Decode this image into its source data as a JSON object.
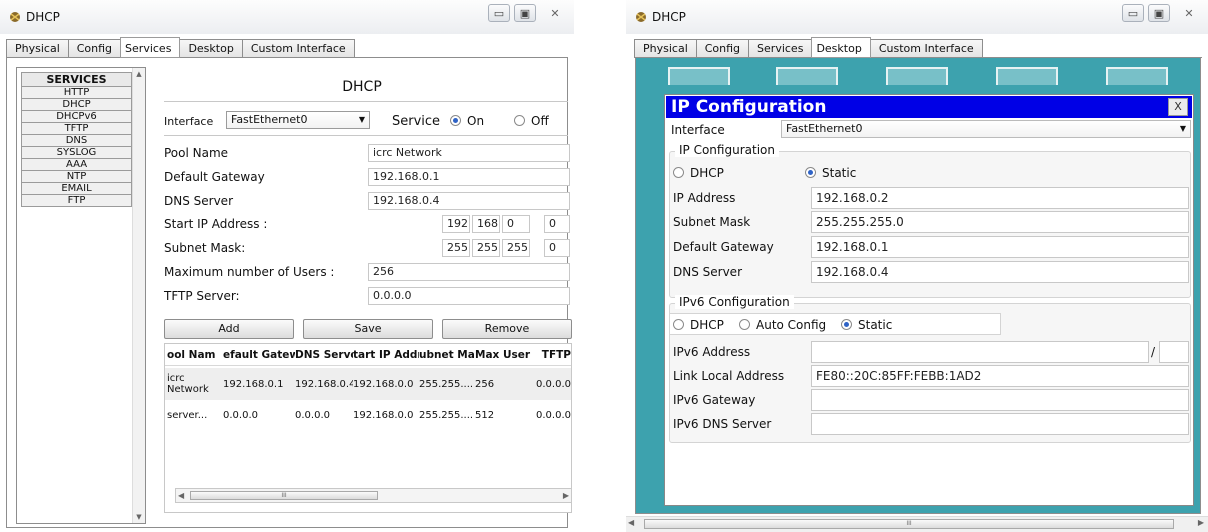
{
  "left_window": {
    "title": "DHCP",
    "tabs": [
      "Physical",
      "Config",
      "Services",
      "Desktop",
      "Custom Interface"
    ],
    "selected_tab": "Services",
    "services": {
      "header": "SERVICES",
      "items": [
        "HTTP",
        "DHCP",
        "DHCPv6",
        "TFTP",
        "DNS",
        "SYSLOG",
        "AAA",
        "NTP",
        "EMAIL",
        "FTP"
      ]
    },
    "panel": {
      "title": "DHCP",
      "interface_label": "Interface",
      "interface_value": "FastEthernet0",
      "service_label": "Service",
      "on_label": "On",
      "off_label": "Off",
      "service_state": "On",
      "pool_name_label": "Pool Name",
      "pool_name_value": "icrc Network",
      "gateway_label": "Default Gateway",
      "gateway_value": "192.168.0.1",
      "dns_label": "DNS Server",
      "dns_value": "192.168.0.4",
      "start_ip_label": "Start IP Address :",
      "start_ip": [
        "192",
        "168",
        "0",
        "0"
      ],
      "subnet_label": "Subnet Mask:",
      "subnet": [
        "255",
        "255",
        "255",
        "0"
      ],
      "max_users_label": "Maximum number of Users :",
      "max_users_value": "256",
      "tftp_label": "TFTP Server:",
      "tftp_value": "0.0.0.0",
      "add_label": "Add",
      "save_label": "Save",
      "remove_label": "Remove",
      "table": {
        "headers": [
          "ool Nam",
          "efault Gatewa",
          "DNS Serve",
          "tart IP Addre",
          "ubnet Mas",
          "Max User",
          "TFTP"
        ],
        "rows": [
          [
            "icrc Network",
            "192.168.0.1",
            "192.168.0.4",
            "192.168.0.0",
            "255.255....",
            "256",
            "0.0.0.0"
          ],
          [
            "server...",
            "0.0.0.0",
            "0.0.0.0",
            "192.168.0.0",
            "255.255....",
            "512",
            "0.0.0.0"
          ]
        ]
      },
      "scroll_grip": "III"
    }
  },
  "right_window": {
    "title": "DHCP",
    "tabs": [
      "Physical",
      "Config",
      "Services",
      "Desktop",
      "Custom Interface"
    ],
    "selected_tab": "Desktop",
    "ipconfig": {
      "title": "IP Configuration",
      "close_label": "X",
      "interface_label": "Interface",
      "interface_value": "FastEthernet0",
      "ipv4_group": "IP Configuration",
      "dhcp_label": "DHCP",
      "static_label": "Static",
      "mode": "Static",
      "ip_label": "IP Address",
      "ip_value": "192.168.0.2",
      "mask_label": "Subnet Mask",
      "mask_value": "255.255.255.0",
      "gw_label": "Default Gateway",
      "gw_value": "192.168.0.1",
      "dns_label": "DNS Server",
      "dns_value": "192.168.0.4",
      "ipv6_group": "IPv6 Configuration",
      "v6_dhcp_label": "DHCP",
      "v6_auto_label": "Auto Config",
      "v6_static_label": "Static",
      "v6_mode": "Static",
      "v6_addr_label": "IPv6 Address",
      "v6_addr_value": "",
      "v6_prefix_sep": "/",
      "link_local_label": "Link Local Address",
      "link_local_value": "FE80::20C:85FF:FEBB:1AD2",
      "v6_gw_label": "IPv6 Gateway",
      "v6_gw_value": "",
      "v6_dns_label": "IPv6 DNS Server",
      "v6_dns_value": ""
    },
    "scroll_grip": "III"
  },
  "colors": {
    "ipconfig_header": "#0000e6",
    "desktop_bg": "#3da2ae",
    "radio_selected": "#2f63c6"
  }
}
